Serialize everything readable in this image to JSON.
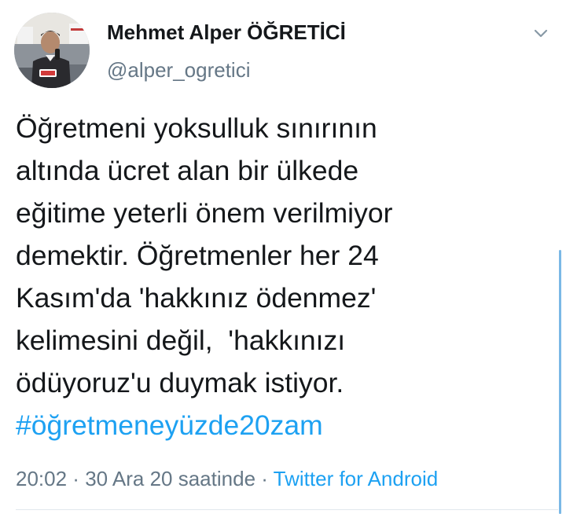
{
  "author": {
    "display_name": "Mehmet Alper ÖĞRETİCİ",
    "handle": "@alper_ogretici",
    "avatar_icon": "profile-photo"
  },
  "tweet": {
    "lines": [
      "Öğretmeni yoksulluk sınırının",
      "altında ücret alan bir ülkede",
      "eğitime yeterli önem verilmiyor",
      "demektir. Öğretmenler her 24",
      "Kasım'da 'hakkınız ödenmez'",
      "kelimesini değil,  'hakkınızı",
      "ödüyoruz'u duymak istiyor."
    ],
    "hashtag": "#öğretmeneyüzde20zam"
  },
  "meta": {
    "time": "20:02",
    "date": "30 Ara 20 saatinde",
    "separator": " · ",
    "source": "Twitter for Android"
  },
  "colors": {
    "link": "#1da1f2",
    "secondary_text": "#657786",
    "primary_text": "#14171a"
  }
}
